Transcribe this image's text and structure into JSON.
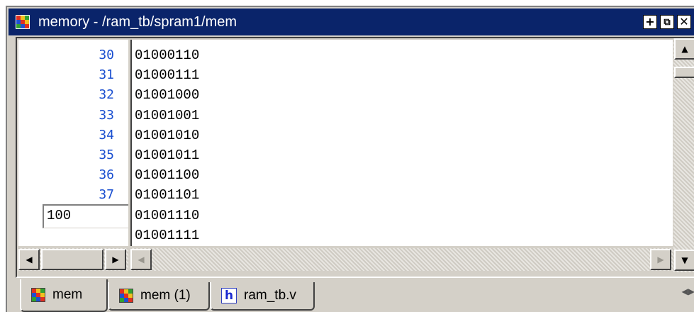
{
  "window": {
    "title": "memory - /ram_tb/spram1/mem",
    "buttons": [
      "+",
      "⧉",
      "✕"
    ]
  },
  "memory": {
    "addresses": [
      "30",
      "31",
      "32",
      "33",
      "34",
      "35",
      "36",
      "37",
      "",
      ""
    ],
    "values": [
      "01000110",
      "01000111",
      "01001000",
      "01001001",
      "01001010",
      "01001011",
      "01001100",
      "01001101",
      "01001110",
      "01001111"
    ],
    "goto_value": "100"
  },
  "tabs": [
    {
      "label": "mem",
      "icon": "grid-icon",
      "active": true
    },
    {
      "label": "mem (1)",
      "icon": "grid-icon",
      "active": false
    },
    {
      "label": "ram_tb.v",
      "icon": "verilog-file-icon",
      "icon_glyph": "h",
      "active": false
    }
  ],
  "icon_colors": [
    "#e03020",
    "#f0c020",
    "#30a030",
    "#2050d0",
    "#e03020",
    "#f0c020",
    "#30a030",
    "#2050d0",
    "#e03020"
  ]
}
